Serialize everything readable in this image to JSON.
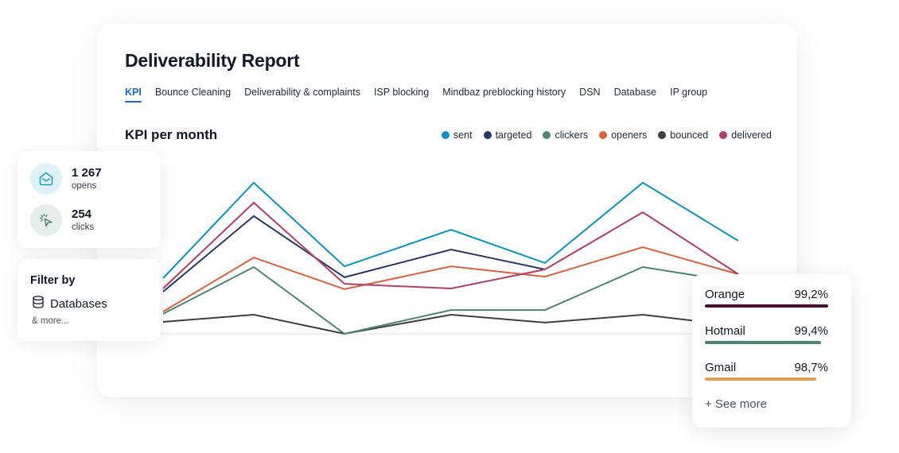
{
  "report": {
    "title": "Deliverability Report",
    "tabs": [
      {
        "label": "KPI",
        "active": true
      },
      {
        "label": "Bounce Cleaning",
        "active": false
      },
      {
        "label": "Deliverability & complaints",
        "active": false
      },
      {
        "label": "ISP blocking",
        "active": false
      },
      {
        "label": "Mindbaz preblocking history",
        "active": false
      },
      {
        "label": "DSN",
        "active": false
      },
      {
        "label": "Database",
        "active": false
      },
      {
        "label": "IP group",
        "active": false
      }
    ]
  },
  "chart_data": {
    "type": "line",
    "title": "KPI per month",
    "xlabel": "",
    "ylabel": "",
    "x": [
      1,
      2,
      3,
      4,
      5,
      6,
      7
    ],
    "ylim": [
      0,
      100
    ],
    "grid": false,
    "legend_position": "top-right",
    "series": [
      {
        "name": "sent",
        "color": "#0a93c4",
        "values": [
          31.8,
          86.4,
          38.6,
          59.5,
          40.5,
          86.4,
          53.2
        ]
      },
      {
        "name": "targeted",
        "color": "#263768",
        "values": [
          24.1,
          67.3,
          32.3,
          48.2,
          36.8
        ]
      },
      {
        "name": "clickers",
        "color": "#4c8672",
        "values": [
          11.4,
          38.2,
          0,
          13.6,
          13.6,
          38.2,
          29.5
        ]
      },
      {
        "name": "openers",
        "color": "#d9623c",
        "values": [
          12.7,
          43.6,
          25.5,
          38.6,
          32.7,
          49.5,
          34.1
        ]
      },
      {
        "name": "bounced",
        "color": "#3f3f3f",
        "values": [
          6.8,
          10.9,
          0,
          10.9,
          6.4,
          10.9,
          4.5
        ]
      },
      {
        "name": "delivered",
        "color": "#b43d69",
        "values": [
          25.9,
          75.0,
          28.6,
          25.9,
          36.8,
          69.5,
          34.1
        ]
      }
    ]
  },
  "stats": {
    "opens": {
      "value": "1 267",
      "label": "opens",
      "icon": "envelope-open-icon"
    },
    "clicks": {
      "value": "254",
      "label": "clicks",
      "icon": "cursor-click-icon"
    }
  },
  "filter": {
    "title": "Filter by",
    "item": "Databases",
    "item_icon": "database-icon",
    "more": "& more..."
  },
  "isp": {
    "rows": [
      {
        "name": "Orange",
        "value": "99,2%",
        "fill": 1.0,
        "color": "#4a0d2f"
      },
      {
        "name": "Hotmail",
        "value": "99,4%",
        "fill": 0.94,
        "color": "#4c8672"
      },
      {
        "name": "Gmail",
        "value": "98,7%",
        "fill": 0.905,
        "color": "#e0a150"
      }
    ],
    "see_more": "+ See more"
  }
}
